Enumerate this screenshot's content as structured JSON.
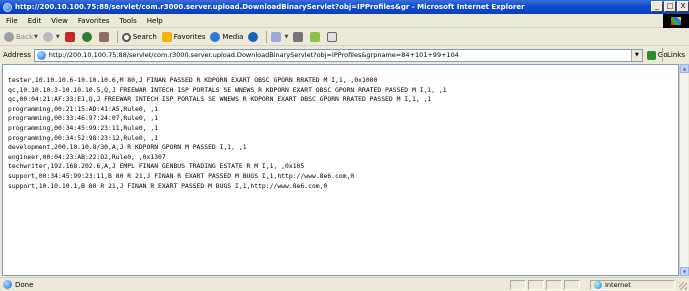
{
  "window": {
    "title": "http://200.10.100.75:88/servlet/com.r3000.server.upload.DownloadBinaryServlet?obj=IPProfiles&gr - Microsoft Internet Explorer",
    "min_glyph": "_",
    "max_glyph": "□",
    "close_glyph": "X"
  },
  "menu": [
    "File",
    "Edit",
    "View",
    "Favorites",
    "Tools",
    "Help"
  ],
  "toolbar": {
    "back_label": "Back",
    "search_label": "Search",
    "favorites_label": "Favorites",
    "media_label": "Media"
  },
  "address": {
    "label": "Address",
    "url": "http://200.10.100.75:88/servlet/com.r3000.server.upload.DownloadBinaryServlet?obj=IPProfiles&grpname=84+101+99+104",
    "go_label": "Go",
    "links_label": "Links"
  },
  "content": {
    "lines": [
      "tester,10.10.10.6-10.10.10.6,M 80,J FINAN PASSED R KDPORN EXART OBSC GPORN RRATED M I,1, ,0x1000",
      "qc,10.10.10.3-10.10.10.5,Q,J FREEWAR INTECH ISP PORTALS SE WNEWS R KDPORN EXART OBSC GPORN RRATED PASSED M I,1, ,1",
      "qc,00:04:21:AF:33:E1,Q,J FREEWAR INTECH ISP PORTALS SE WNEWS R KDPORN EXART OBSC GPORN RRATED PASSED M I,1, ,1",
      "programming,00:21:15:AD:41:A5,Rule0, ,1",
      "programming,00:33:46:97:24:07,Rule0, ,1",
      "programming,00:34:45:99:23:11,Rule0, ,1",
      "programming,00:34:52:98:23:12,Rule0, ,1",
      "development,200.10.10.8/30,A,J R KDPORN GPORN M PASSED I,1, ,1",
      "engineer,00:04:23:AB:22:D2,Rule0, ,0x1307",
      "techwriter,192.168.202.6,A,J EMPL FINAN GENBUS TRADING ESTATE R M I,1, ,0x105",
      "support,00:34:45:99:23:11,B 80 R 21,J FINAN R EXART PASSED M BUGS I,1,http://www.8e6.com,0",
      "support,10.10.10.1,B 80 R 21,J FINAN R EXART PASSED M BUGS I,1,http://www.8e6.com,0"
    ]
  },
  "status": {
    "text": "Done",
    "zone": "Internet"
  }
}
